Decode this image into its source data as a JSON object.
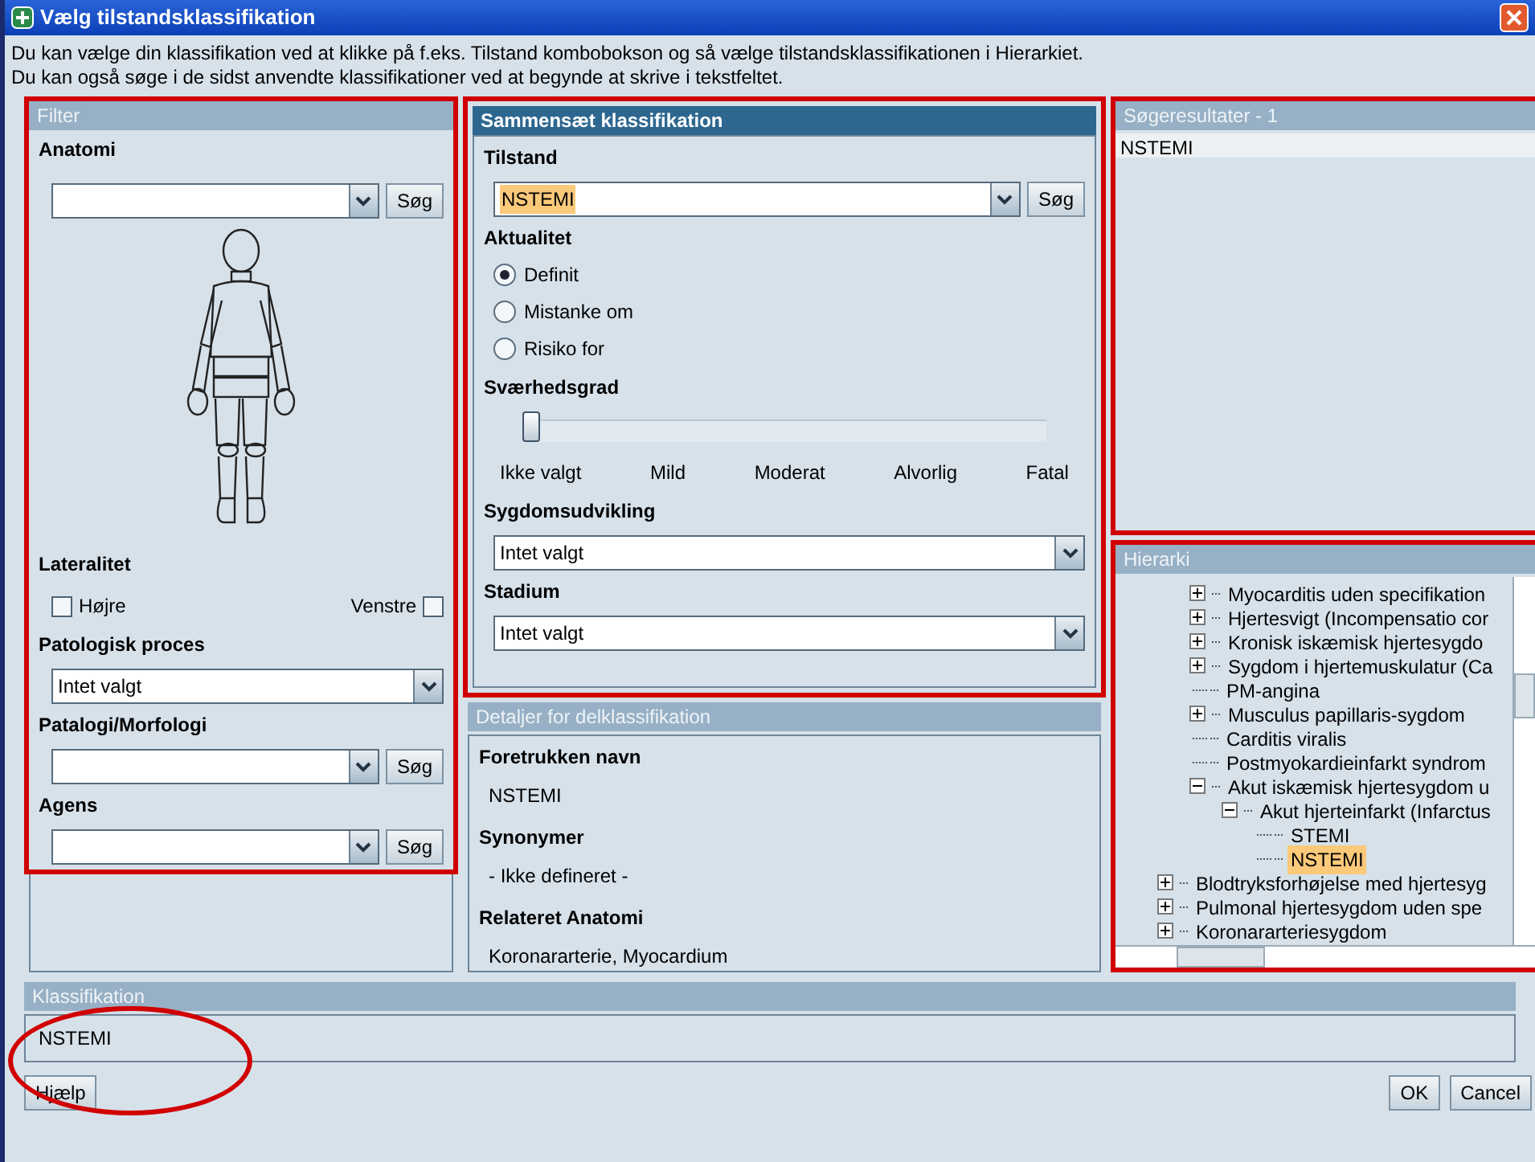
{
  "window": {
    "title": "Vælg tilstandsklassifikation"
  },
  "instructions": [
    "Du kan vælge din klassifikation ved at klikke på f.eks. Tilstand kombobokson og så vælge tilstandsklassifikationen i Hierarkiet.",
    "Du kan også søge i de sidst anvendte klassifikationer ved at begynde at skrive i tekstfeltet."
  ],
  "filter": {
    "title": "Filter",
    "anatomi": {
      "label": "Anatomi",
      "button": "Søg"
    },
    "lateralitet": {
      "label": "Lateralitet",
      "options": [
        {
          "label": "Højre",
          "checked": false
        },
        {
          "label": "Venstre",
          "checked": false
        }
      ]
    },
    "patologisk_proces": {
      "label": "Patologisk proces",
      "value": "Intet valgt"
    },
    "patologi_morfologi": {
      "label": "Patalogi/Morfologi",
      "button": "Søg"
    },
    "agens": {
      "label": "Agens",
      "button": "Søg"
    }
  },
  "compose": {
    "title": "Sammensæt klassifikation",
    "tilstand": {
      "label": "Tilstand",
      "value": "NSTEMI",
      "button": "Søg"
    },
    "aktualitet": {
      "label": "Aktualitet",
      "options": [
        {
          "label": "Definit",
          "selected": true
        },
        {
          "label": "Mistanke om",
          "selected": false
        },
        {
          "label": "Risiko for",
          "selected": false
        }
      ]
    },
    "svaerhedsgrad": {
      "label": "Sværhedsgrad",
      "level": 0,
      "ticks": [
        "Ikke valgt",
        "Mild",
        "Moderat",
        "Alvorlig",
        "Fatal"
      ]
    },
    "sygdomsudvikling": {
      "label": "Sygdomsudvikling",
      "value": "Intet valgt"
    },
    "stadium": {
      "label": "Stadium",
      "value": "Intet valgt"
    }
  },
  "details": {
    "title": "Detaljer for delklassifikation",
    "sections": [
      {
        "label": "Foretrukken navn",
        "value": "NSTEMI"
      },
      {
        "label": "Synonymer",
        "value": "- Ikke defineret -"
      },
      {
        "label": "Relateret Anatomi",
        "value": "Koronararterie, Myocardium"
      }
    ]
  },
  "search_results": {
    "title": "Søgeresultater - 1",
    "items": [
      {
        "label": "NSTEMI",
        "selected": true
      }
    ]
  },
  "hierarchy": {
    "title": "Hierarki",
    "scrolled_parent_children": [
      {
        "label": "Myocarditis uden specifikation",
        "expanded": false,
        "selected": false
      },
      {
        "label": "Hjertesvigt (Incompensatio cor",
        "expanded": false,
        "selected": false
      },
      {
        "label": "Kronisk iskæmisk hjertesygdo",
        "expanded": false,
        "selected": false
      },
      {
        "label": "Sygdom i hjertemuskulatur (Ca",
        "expanded": false,
        "selected": false
      },
      {
        "label": "PM-angina",
        "selected": false
      },
      {
        "label": "Musculus papillaris-sygdom",
        "expanded": false,
        "selected": false
      },
      {
        "label": "Carditis viralis",
        "selected": false
      },
      {
        "label": "Postmyokardieinfarkt syndrom",
        "selected": false
      },
      {
        "label": "Akut iskæmisk hjertesygdom u",
        "expanded": true,
        "selected": false,
        "children": [
          {
            "label": "Akut hjerteinfarkt (Infarctus",
            "expanded": true,
            "selected": false,
            "children": [
              {
                "label": "STEMI",
                "selected": false
              },
              {
                "label": "NSTEMI",
                "selected": true
              }
            ]
          }
        ]
      }
    ],
    "nodes": [
      {
        "label": "Blodtryksforhøjelse med hjertesyg",
        "expanded": false,
        "selected": false
      },
      {
        "label": "Pulmonal hjertesygdom uden spe",
        "expanded": false,
        "selected": false
      },
      {
        "label": "Koronararteriesygdom",
        "expanded": false,
        "selected": false
      }
    ]
  },
  "klassifikation": {
    "title": "Klassifikation",
    "value": "NSTEMI"
  },
  "buttons": {
    "help": "Hjælp",
    "ok": "OK",
    "cancel": "Cancel"
  }
}
